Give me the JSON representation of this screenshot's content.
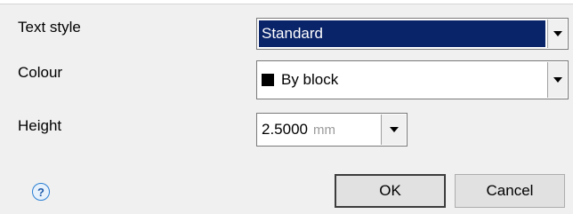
{
  "form": {
    "text_style": {
      "label": "Text style",
      "value": "Standard"
    },
    "colour": {
      "label": "Colour",
      "value": "By block",
      "swatch_color": "#000000"
    },
    "height": {
      "label": "Height",
      "value": "2.5000",
      "unit": "mm"
    }
  },
  "buttons": {
    "ok_label": "OK",
    "cancel_label": "Cancel"
  },
  "help": {
    "glyph": "?",
    "icon": "help-icon"
  },
  "colors": {
    "selection": "#0a246a",
    "background": "#f0f0f0",
    "help_accent": "#2a7fd4"
  }
}
